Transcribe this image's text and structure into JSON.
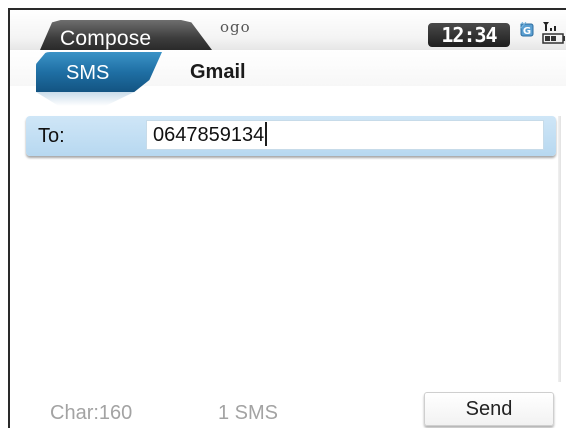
{
  "titlebar": {
    "title": "Compose",
    "app_logo": "ogo",
    "clock": "12:34",
    "icons": [
      "signal-icon",
      "battery-icon"
    ]
  },
  "tabs": [
    {
      "label": "SMS",
      "active": true
    },
    {
      "label": "Gmail",
      "active": false
    }
  ],
  "recipient": {
    "label": "To:",
    "value": "0647859134"
  },
  "message": {
    "value": ""
  },
  "footer": {
    "char_count": "Char:160",
    "sms_count": "1 SMS",
    "send_label": "Send"
  },
  "colors": {
    "accent": "#1f6fa4",
    "field_bg": "#cfe6f7",
    "muted_text": "#a3a3a3",
    "titlebar_tab": "#3d3d3d"
  }
}
